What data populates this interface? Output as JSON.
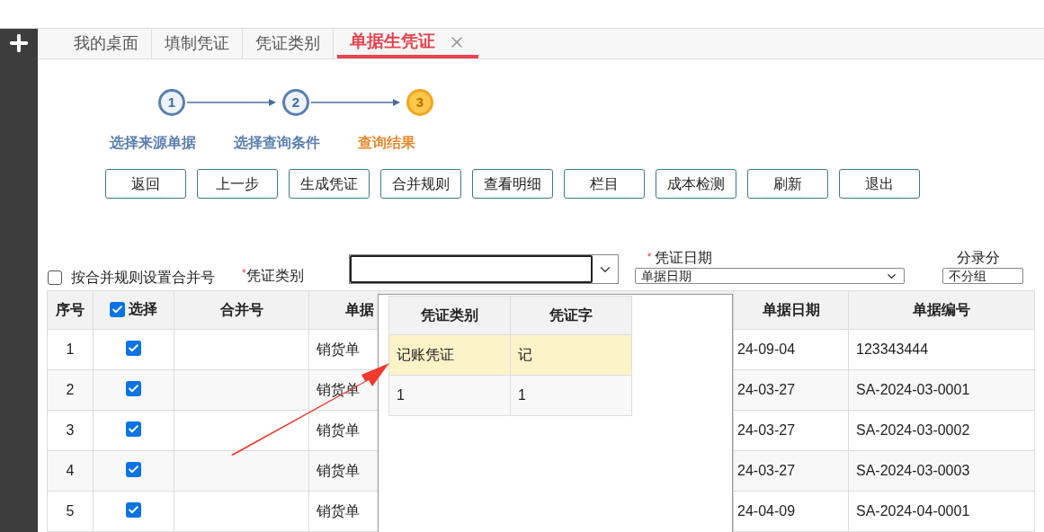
{
  "tabs": [
    {
      "label": "我的桌面",
      "selected": false,
      "closable": false
    },
    {
      "label": "填制凭证",
      "selected": false,
      "closable": false
    },
    {
      "label": "凭证类别",
      "selected": false,
      "closable": false
    },
    {
      "label": "单据生凭证",
      "selected": true,
      "closable": true
    }
  ],
  "steps": [
    {
      "number": "1",
      "label": "选择来源单据",
      "current": false
    },
    {
      "number": "2",
      "label": "选择查询条件",
      "current": false
    },
    {
      "number": "3",
      "label": "查询结果",
      "current": true
    }
  ],
  "buttons": [
    "返回",
    "上一步",
    "生成凭证",
    "合并规则",
    "查看明细",
    "栏目",
    "成本检测",
    "刷新",
    "退出"
  ],
  "filters": {
    "merge_checkbox": {
      "label": "按合并规则设置合并号",
      "checked": false
    },
    "voucher_type": {
      "mark": "*",
      "label": "凭证类别"
    },
    "voucher_date": {
      "mark": "*",
      "label": "凭证日期",
      "value": "单据日期"
    },
    "entry_group": {
      "label": "分录分",
      "value": "不分组"
    }
  },
  "table": {
    "columns": [
      {
        "label": "序号"
      },
      {
        "label": "选择",
        "checked": true
      },
      {
        "label": "合并号"
      },
      {
        "label": "单据"
      },
      {},
      {
        "label": "单据日期"
      },
      {
        "label": "单据编号"
      }
    ],
    "rows": [
      {
        "index": "1",
        "selected": true,
        "merge_no": "",
        "type": "销货单",
        "date": "24-09-04",
        "number": "123343444"
      },
      {
        "index": "2",
        "selected": true,
        "merge_no": "",
        "type": "销货单",
        "date": "24-03-27",
        "number": "SA-2024-03-0001"
      },
      {
        "index": "3",
        "selected": true,
        "merge_no": "",
        "type": "销货单",
        "date": "24-03-27",
        "number": "SA-2024-03-0002"
      },
      {
        "index": "4",
        "selected": true,
        "merge_no": "",
        "type": "销货单",
        "date": "24-03-27",
        "number": "SA-2024-03-0003"
      },
      {
        "index": "5",
        "selected": true,
        "merge_no": "",
        "type": "销货单",
        "date": "24-04-09",
        "number": "SA-2024-04-0001"
      }
    ]
  },
  "dropdown": {
    "columns": [
      "凭证类别",
      "凭证字"
    ],
    "rows": [
      {
        "cells": [
          "记账凭证",
          "记"
        ],
        "selected": true
      },
      {
        "cells": [
          "1",
          "1"
        ],
        "selected": false
      }
    ]
  }
}
